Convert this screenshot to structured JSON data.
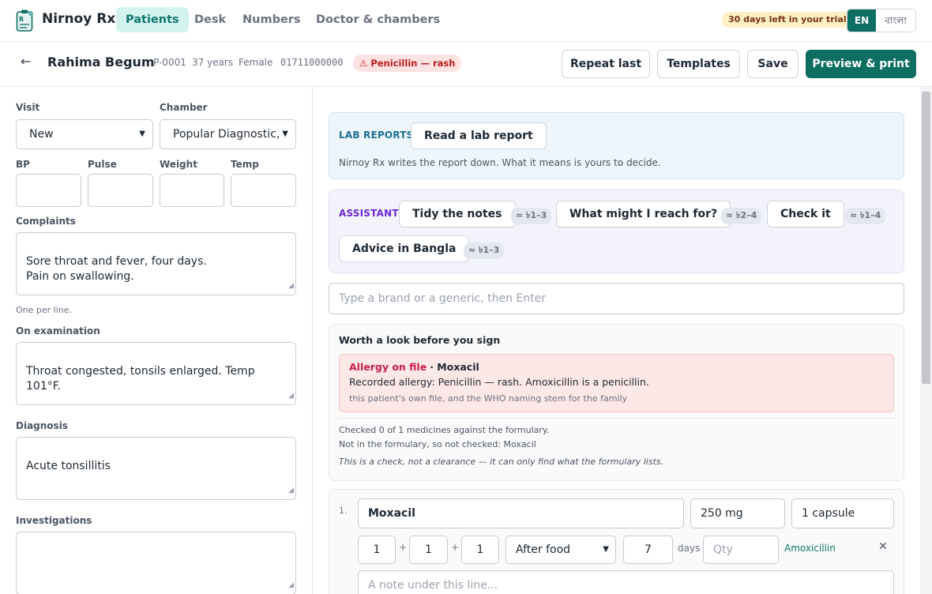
{
  "app": {
    "name": "Nirnoy Rx",
    "logo_icon": "prescription-pad-icon",
    "accent": "#0f6e62"
  },
  "nav": {
    "tabs": [
      {
        "label": "Patients",
        "active": true
      },
      {
        "label": "Desk"
      },
      {
        "label": "Numbers"
      },
      {
        "label": "Doctor & chambers"
      }
    ]
  },
  "trial": {
    "text": "30 days left in your trial"
  },
  "language": {
    "en": "EN",
    "bn": "বাংলা",
    "selected": "EN"
  },
  "patient": {
    "name": "Rahima Begum",
    "id": "P-0001",
    "age": "37 years",
    "sex": "Female",
    "phone": "01711000000",
    "allergy_badge": "⚠ Penicillin — rash"
  },
  "actions": {
    "repeat": "Repeat last",
    "templates": "Templates",
    "save": "Save",
    "print": "Preview & print"
  },
  "form": {
    "visit_label": "Visit",
    "visit_value": "New",
    "chamber_label": "Chamber",
    "chamber_value": "Popular Diagnostic, ",
    "bp_label": "BP",
    "pulse_label": "Pulse",
    "weight_label": "Weight",
    "temp_label": "Temp",
    "complaints_label": "Complaints",
    "complaints_value": "Sore throat and fever, four days.\nPain on swallowing.",
    "complaints_hint": "One per line.",
    "exam_label": "On examination",
    "exam_value": "Throat congested, tonsils enlarged. Temp 101°F.",
    "diagnosis_label": "Diagnosis",
    "diagnosis_value": "Acute tonsillitis",
    "investigations_label": "Investigations",
    "investigations_value": ""
  },
  "lab": {
    "tag": "LAB REPORTS",
    "button": "Read a lab report",
    "note": "Nirnoy Rx writes the report down. What it means is yours to decide."
  },
  "assistant": {
    "tag": "ASSISTANT",
    "buttons": [
      {
        "label": "Tidy the notes",
        "cost": "≈ ৳1–3"
      },
      {
        "label": "What might I reach for?",
        "cost": "≈ ৳2–4"
      },
      {
        "label": "Check it",
        "cost": "≈ ৳1–4"
      },
      {
        "label": "Advice in Bangla",
        "cost": "≈ ৳1–3"
      }
    ]
  },
  "search": {
    "placeholder": "Type a brand or a generic, then Enter"
  },
  "checks": {
    "title": "Worth a look before you sign",
    "alert_title": "Allergy on file",
    "alert_drug": "· Moxacil",
    "alert_body": "Recorded allergy: Penicillin — rash. Amoxicillin is a penicillin.",
    "alert_source": "this patient's own file, and the WHO naming stem for the family",
    "checked_line": "Checked 0 of 1 medicines against the formulary.",
    "missing_line": "Not in the formulary, so not checked: Moxacil",
    "disclaimer": "This is a check, not a clearance — it can only find what the formulary lists."
  },
  "rx": {
    "items": [
      {
        "number": "1.",
        "brand": "Moxacil",
        "strength": "250 mg",
        "form": "1 capsule",
        "morning": "1",
        "noon": "1",
        "night": "1",
        "timing": "After food",
        "days": "7",
        "days_label": "days",
        "qty_placeholder": "Qty",
        "generic": "Amoxicillin",
        "note_placeholder": "A note under this line..."
      }
    ]
  }
}
